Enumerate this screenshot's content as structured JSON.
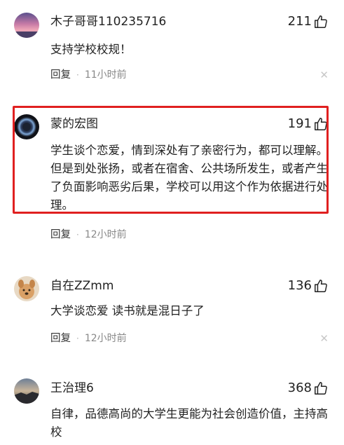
{
  "comments": [
    {
      "username": "木子哥哥110235716",
      "likes": "211",
      "text": "支持学校校规！",
      "reply_label": "回复",
      "separator": "·",
      "time": "11小时前",
      "close": "✕",
      "avatar_icon": "sunset-sky-avatar",
      "highlighted": false
    },
    {
      "username": "蒙的宏图",
      "likes": "191",
      "text": "学生谈个恋爱，情到深处有了亲密行为，都可以理解。但是到处张扬，或者在宿舍、公共场所发生，或者产生了负面影响恶劣后果，学校可以用这个作为依据进行处理。",
      "reply_label": "回复",
      "separator": "·",
      "time": "12小时前",
      "avatar_icon": "dark-glow-avatar",
      "highlighted": true,
      "highlight_color": "#e02020"
    },
    {
      "username": "自在ZZmm",
      "likes": "136",
      "text": "大学谈恋爱 读书就是混日子了",
      "reply_label": "回复",
      "separator": "·",
      "time": "12小时前",
      "close": "✕",
      "avatar_icon": "cartoon-dog-avatar",
      "highlighted": false
    },
    {
      "username": "王治理6",
      "likes": "368",
      "text": "自律，品德高尚的大学生更能为社会创造价值，主持高校",
      "avatar_icon": "dusk-landscape-avatar",
      "highlighted": false
    }
  ],
  "like_icon": "thumbs-up-icon",
  "colors": {
    "text": "#222222",
    "meta": "#888888",
    "highlight": "#e02020"
  }
}
